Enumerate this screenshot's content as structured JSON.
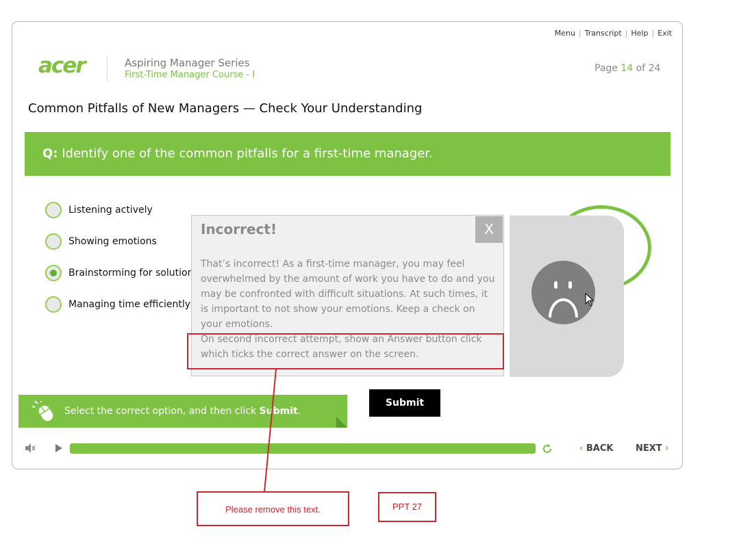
{
  "header": {
    "nav": [
      "Menu",
      "Transcript",
      "Help",
      "Exit"
    ],
    "logo": "acer",
    "series_title": "Aspiring Manager Series",
    "course_title": "First-Time Manager Course - I",
    "page_prefix": "Page",
    "page_current": "14",
    "page_of": "of 24"
  },
  "page_title": "Common Pitfalls of New Managers — Check Your Understanding",
  "question": {
    "prefix": "Q:",
    "text": "Identify one of the common pitfalls for a first-time manager."
  },
  "options": [
    {
      "label": "Listening actively",
      "selected": false
    },
    {
      "label": "Showing emotions",
      "selected": false
    },
    {
      "label": "Brainstorming for solutions",
      "selected": true
    },
    {
      "label": "Managing time efficiently",
      "selected": false
    }
  ],
  "feedback": {
    "title": "Incorrect!",
    "close": "X",
    "body": "That’s incorrect! As a first-time manager, you may feel overwhelmed by the amount of work you have to do and you may be confronted with difficult situations. At such times, it is important to not show your emotions. Keep a check on your emotions.",
    "note": "On second incorrect attempt, show an Answer button click which ticks the correct answer on the screen."
  },
  "instruction": {
    "text_before": "Select the correct option, and then click ",
    "bold": "Submit",
    "text_after": "."
  },
  "submit_label": "Submit",
  "player": {
    "progress": 1.0,
    "back_label": "BACK",
    "next_label": "NEXT"
  },
  "annotations": {
    "comment": "Please remove this text.",
    "ppt": "PPT 27"
  },
  "colors": {
    "accent_green": "#7dc242",
    "annotation_red": "#d0242f"
  },
  "icons": [
    "volume-icon",
    "play-icon",
    "reload-icon",
    "mouse-click-icon",
    "sad-face-icon",
    "cursor-icon"
  ]
}
